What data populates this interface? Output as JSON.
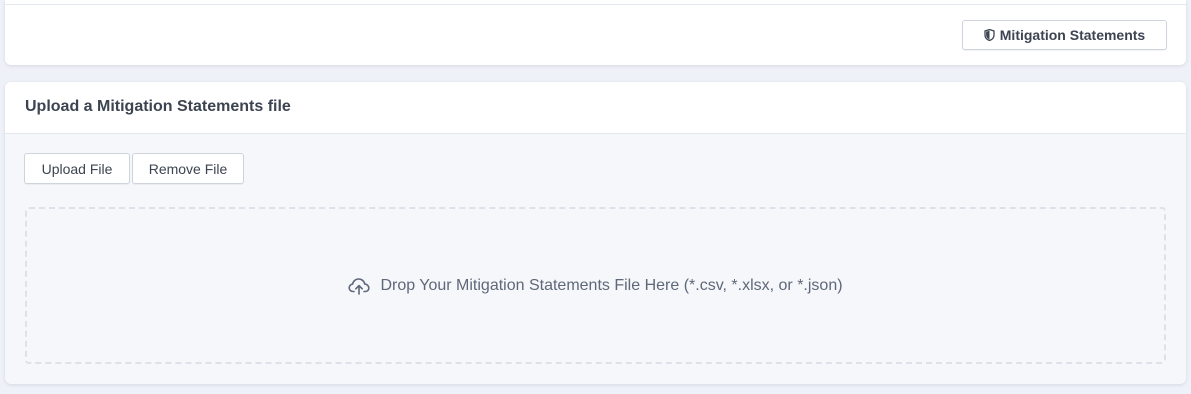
{
  "toolbar": {
    "mitigation_statements_label": "Mitigation Statements",
    "mitigation_icon": "shield-icon"
  },
  "upload_card": {
    "title": "Upload a Mitigation Statements file",
    "upload_button_label": "Upload File",
    "remove_button_label": "Remove File",
    "dropzone_text": "Drop Your Mitigation Statements File Here (*.csv, *.xlsx, or *.json)",
    "dropzone_icon": "cloud-upload-icon"
  },
  "colors": {
    "page_background": "#eef1f7",
    "card_background": "#ffffff",
    "text": "#3d4451",
    "muted_text": "#5f6878",
    "border": "#cfd4dc"
  }
}
